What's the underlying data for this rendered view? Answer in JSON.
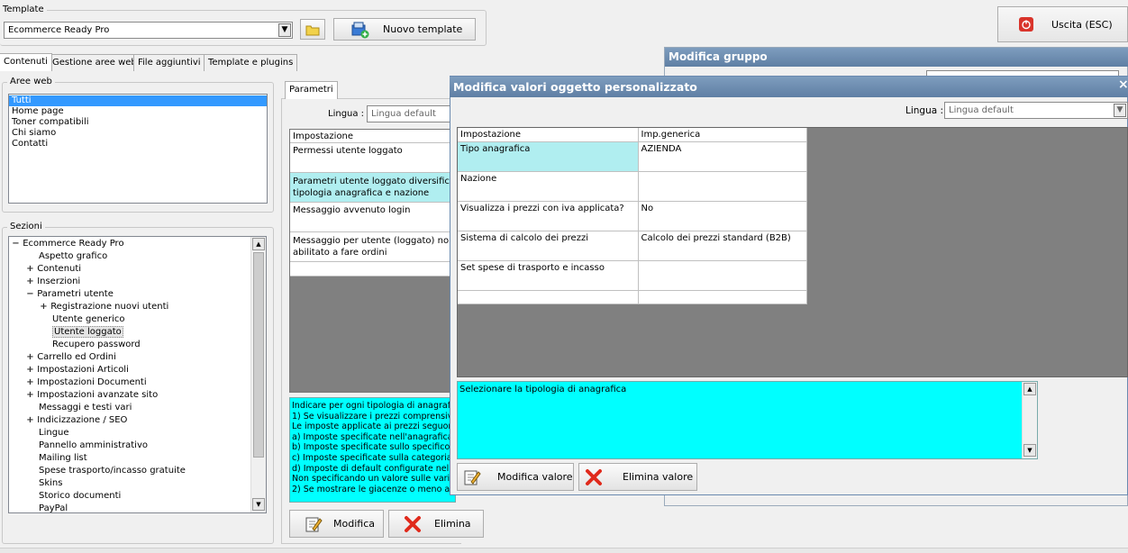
{
  "template": {
    "label": "Template",
    "selected": "Ecommerce Ready Pro",
    "new_template_button": "Nuovo template"
  },
  "exit_button": "Uscita (ESC)",
  "main_tabs": [
    {
      "label": "Contenuti"
    },
    {
      "label": "Gestione aree web"
    },
    {
      "label": "File aggiuntivi"
    },
    {
      "label": "Template e plugins"
    }
  ],
  "aree_web": {
    "legend": "Aree web",
    "items": [
      "Tutti",
      "Home page",
      "Toner compatibili",
      "Chi siamo",
      "Contatti"
    ]
  },
  "sezioni": {
    "legend": "Sezioni",
    "tree": [
      {
        "label": "Ecommerce Ready Pro",
        "expander": "−"
      },
      {
        "label": "Aspetto grafico",
        "expander": ""
      },
      {
        "label": "Contenuti",
        "expander": "+"
      },
      {
        "label": "Inserzioni",
        "expander": "+"
      },
      {
        "label": "Parametri utente",
        "expander": "−"
      },
      {
        "label": "Registrazione nuovi utenti",
        "expander": "+"
      },
      {
        "label": "Utente generico",
        "expander": ""
      },
      {
        "label": "Utente loggato",
        "expander": ""
      },
      {
        "label": "Recupero password",
        "expander": ""
      },
      {
        "label": "Carrello ed Ordini",
        "expander": "+"
      },
      {
        "label": "Impostazioni Articoli",
        "expander": "+"
      },
      {
        "label": "Impostazioni Documenti",
        "expander": "+"
      },
      {
        "label": "Impostazioni avanzate sito",
        "expander": "+"
      },
      {
        "label": "Messaggi e testi vari",
        "expander": ""
      },
      {
        "label": "Indicizzazione / SEO",
        "expander": "+"
      },
      {
        "label": "Lingue",
        "expander": ""
      },
      {
        "label": "Pannello amministrativo",
        "expander": ""
      },
      {
        "label": "Mailing list",
        "expander": ""
      },
      {
        "label": "Spese trasporto/incasso gratuite",
        "expander": ""
      },
      {
        "label": "Skins",
        "expander": ""
      },
      {
        "label": "Storico documenti",
        "expander": ""
      },
      {
        "label": "PayPal",
        "expander": ""
      }
    ]
  },
  "parametri": {
    "tab": "Parametri",
    "lingua_label": "Lingua :",
    "lingua_value": "Lingua default",
    "column_header": "Impostazione",
    "rows": [
      "Permessi utente loggato",
      "Parametri utente loggato diversificat per tipologia anagrafica e nazione",
      "Messaggio avvenuto login",
      "Messaggio per utente (loggato) non abilitato a fare ordini"
    ],
    "description_lines": [
      "Indicare per ogni tipologia di anagrafica",
      "1) Se visualizzare i prezzi comprensivi di",
      "Le imposte applicate ai prezzi seguono q",
      "a) Imposte specificate nell'anagrafica cli",
      "b) Imposte specificate sullo specifico art",
      "c) Imposte specificate sulla categoria art",
      "d) Imposte di default configurate nell'az",
      "Non specificando un valore sulle varie t",
      "2) Se mostrare le giacenze o meno acca"
    ],
    "modifica_button": "Modifica",
    "elimina_button": "Elimina"
  },
  "modifica_gruppo": {
    "title": "Modifica gruppo"
  },
  "dialog": {
    "title": "Modifica valori oggetto personalizzato",
    "close": "×",
    "lingua_label": "Lingua :",
    "lingua_value": "Lingua default",
    "headers": [
      "Impostazione",
      "Imp.generica"
    ],
    "rows": [
      {
        "setting": "Tipo anagrafica",
        "value": "AZIENDA"
      },
      {
        "setting": "Nazione",
        "value": ""
      },
      {
        "setting": "Visualizza i prezzi con iva applicata?",
        "value": "No"
      },
      {
        "setting": "Sistema di calcolo dei prezzi",
        "value": "Calcolo dei prezzi standard (B2B)"
      },
      {
        "setting": "Set spese di trasporto e incasso",
        "value": ""
      },
      {
        "setting": "",
        "value": ""
      }
    ],
    "description": "Selezionare la tipologia di anagrafica",
    "modifica_valore_button": "Modifica valore",
    "elimina_valore_button": "Elimina valore"
  },
  "colors": {
    "selected_row": "#b0eef0",
    "description_bg": "#00ffff",
    "grid_empty": "#808080",
    "title_bar": "#6a8ab0"
  }
}
